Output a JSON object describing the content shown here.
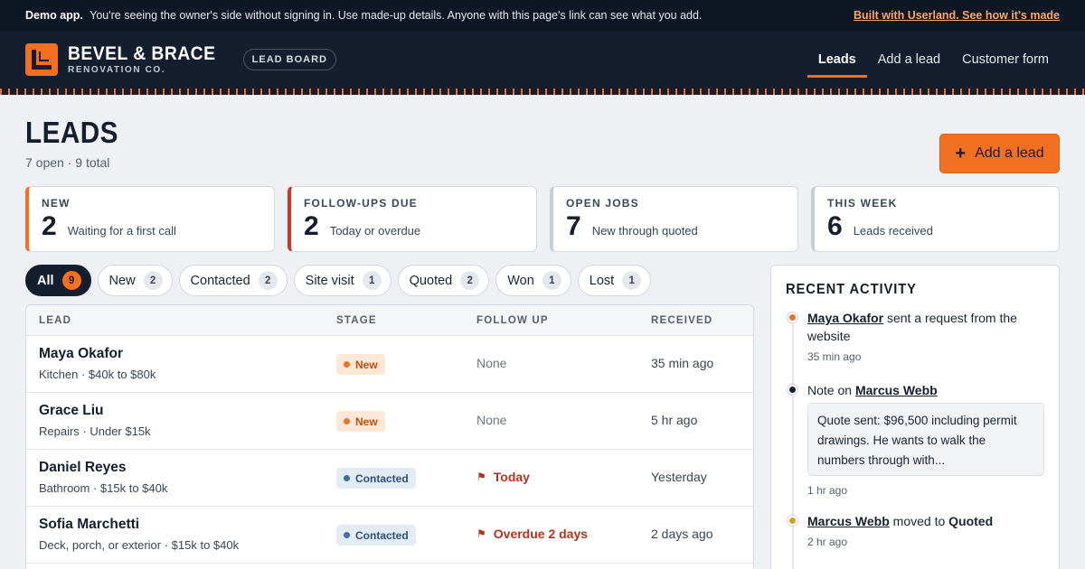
{
  "banner": {
    "bold": "Demo app.",
    "text": "You're seeing the owner's side without signing in. Use made-up details. Anyone with this page's link can see what you add.",
    "link": "Built with Userland. See how it's made"
  },
  "header": {
    "brand_name": "BEVEL & BRACE",
    "brand_sub": "RENOVATION CO.",
    "board_label": "LEAD BOARD",
    "nav": [
      {
        "label": "Leads",
        "active": true
      },
      {
        "label": "Add a lead",
        "active": false
      },
      {
        "label": "Customer form",
        "active": false
      }
    ]
  },
  "page": {
    "title": "LEADS",
    "subtitle": "7 open · 9 total",
    "add_button": "Add a lead"
  },
  "stats": [
    {
      "label": "NEW",
      "value": "2",
      "desc": "Waiting for a first call",
      "accent": "#f36f21"
    },
    {
      "label": "FOLLOW-UPS DUE",
      "value": "2",
      "desc": "Today or overdue",
      "accent": "#c33a2c"
    },
    {
      "label": "OPEN JOBS",
      "value": "7",
      "desc": "New through quoted",
      "accent": "#c9ced6"
    },
    {
      "label": "THIS WEEK",
      "value": "6",
      "desc": "Leads received",
      "accent": "#c9ced6"
    }
  ],
  "filters": [
    {
      "label": "All",
      "count": "9",
      "active": true
    },
    {
      "label": "New",
      "count": "2"
    },
    {
      "label": "Contacted",
      "count": "2"
    },
    {
      "label": "Site visit",
      "count": "1"
    },
    {
      "label": "Quoted",
      "count": "2"
    },
    {
      "label": "Won",
      "count": "1"
    },
    {
      "label": "Lost",
      "count": "1"
    }
  ],
  "table": {
    "headers": {
      "lead": "LEAD",
      "stage": "STAGE",
      "follow": "FOLLOW UP",
      "received": "RECEIVED"
    },
    "rows": [
      {
        "name": "Maya Okafor",
        "meta": "Kitchen · $40k to $80k",
        "stage": "New",
        "follow": "None",
        "received": "35 min ago"
      },
      {
        "name": "Grace Liu",
        "meta": "Repairs · Under $15k",
        "stage": "New",
        "follow": "None",
        "received": "5 hr ago"
      },
      {
        "name": "Daniel Reyes",
        "meta": "Bathroom · $15k to $40k",
        "stage": "Contacted",
        "follow": "Today",
        "received": "Yesterday"
      },
      {
        "name": "Sofia Marchetti",
        "meta": "Deck, porch, or exterior · $15k to $40k",
        "stage": "Contacted",
        "follow": "Overdue 2 days",
        "received": "2 days ago"
      }
    ]
  },
  "activity": {
    "title": "RECENT ACTIVITY",
    "items": [
      {
        "link": "Maya Okafor",
        "text": "sent a request from the website",
        "time": "35 min ago",
        "dot": "#f36f21"
      },
      {
        "prefix": "Note on",
        "link": "Marcus Webb",
        "note": "Quote sent: $96,500 including permit drawings. He wants to walk the numbers through with...",
        "time": "1 hr ago",
        "dot": "#141e2e"
      },
      {
        "link": "Marcus Webb",
        "text": "moved to",
        "strong": "Quoted",
        "time": "2 hr ago",
        "dot": "#c9a227"
      }
    ]
  }
}
